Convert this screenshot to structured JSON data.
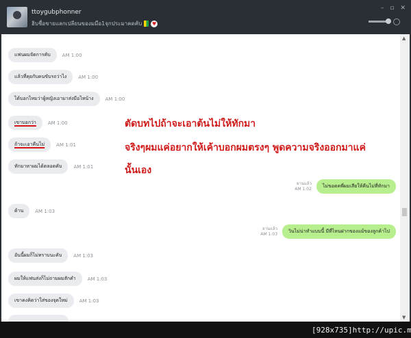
{
  "header": {
    "username": "ttoygubphonner",
    "status_text": "ฮิบชื่อขายแลกเปลียนของมมือ1จุกประมาคดคับ",
    "window_controls": [
      "–",
      "▫",
      "✕"
    ],
    "volume_fraction": 0.9
  },
  "messages": [
    {
      "side": "in",
      "text": "แฟนผมจัดการคับ",
      "time": "AM 1:00"
    },
    {
      "side": "in",
      "text": "แล้วที่คุยกับคนขับรถว่าไง",
      "time": "AM 1:00"
    },
    {
      "side": "in",
      "text": "ได้บอกไหมว่าผู้หญิงเอามาส่งมือไหน้าง",
      "time": "AM 1:00"
    },
    {
      "side": "in",
      "text": "เขาบอกว่า",
      "time": "AM 1:00",
      "underline": true
    },
    {
      "side": "in",
      "text": "ถ้าจะเอาคืนไม่",
      "time": "AM 1:01",
      "underline": true
    },
    {
      "side": "in",
      "text": "ทักมาหาผมได้ตลอดคับ",
      "time": "AM 1:01"
    },
    {
      "side": "out",
      "text": "ไม่ขอดคพี่ผมเสียให้คืนไม่ที่ทักมา",
      "read": "ยานแล้ว",
      "time": "AM 1:02"
    },
    {
      "side": "in",
      "text": "ด้าน",
      "time": "AM 1:03"
    },
    {
      "side": "out",
      "text": "วินไม่น่าทำแบบนี้ มีที่ไหนฝากของแม้ของลูกค้าไป",
      "read": "ยานแล้ว",
      "time": "AM 1:03"
    },
    {
      "side": "in",
      "text": "อันนี้ผมก็ไม่ทราบนะคับ",
      "time": "AM 1:03"
    },
    {
      "side": "in",
      "text": "ผมให้แฟนส่งก็ไม่ถามผมสักคำ",
      "time": "AM 1:03"
    },
    {
      "side": "in",
      "text": "เขาคงคิดว่าใส่ของจุดใหม่",
      "time": "AM 1:03"
    }
  ],
  "annotation": {
    "line1": "ตัดบทไปถ้าจะเอาต้นไม่ให้ทักมา",
    "line2": "จริงๆผมแค่อยากให้เค้าบอกผมตรงๆ พูดความจริงออกมาแค่",
    "line3": "นั้นเอง"
  },
  "watermark": "[928x735]http://upic.me/",
  "colors": {
    "incoming_bubble": "#e9ebef",
    "outgoing_bubble": "#b7ef8e",
    "annotation": "#d01b1b",
    "titlebar": "#2a2f35"
  }
}
